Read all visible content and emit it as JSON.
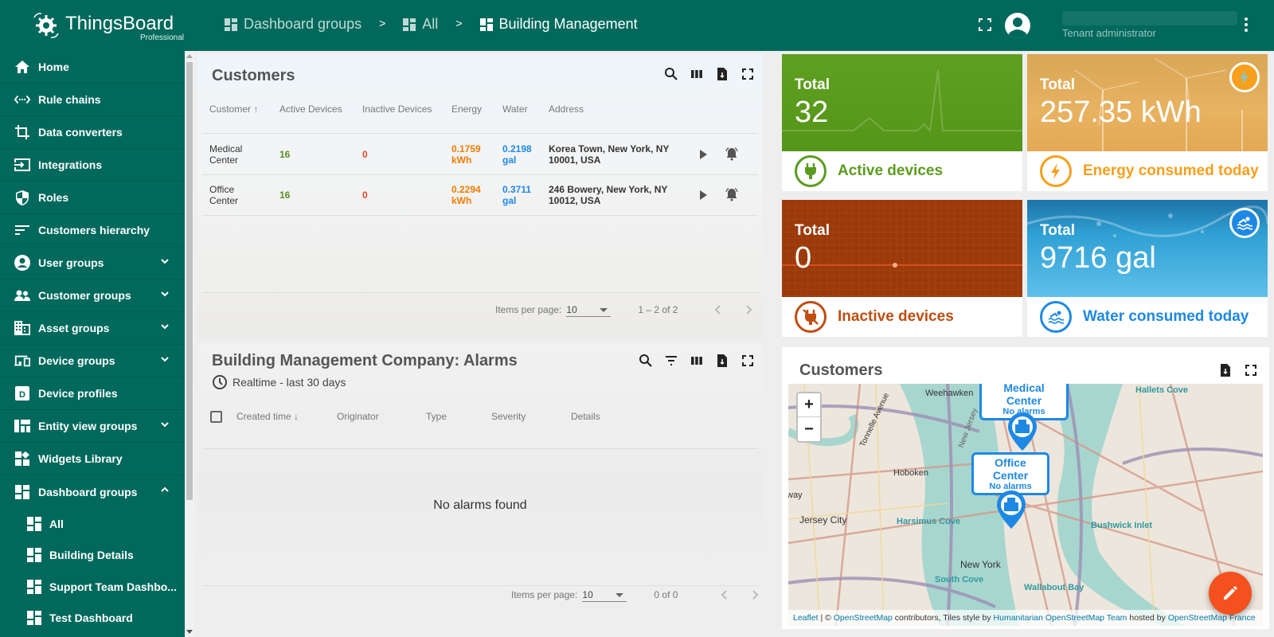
{
  "app": {
    "logo_name": "ThingsBoard",
    "logo_edition": "Professional"
  },
  "breadcrumb": [
    {
      "label": "Dashboard groups"
    },
    {
      "label": "All"
    },
    {
      "label": "Building Management"
    }
  ],
  "breadcrumb_separator": ">",
  "user": {
    "role": "Tenant administrator"
  },
  "sidebar": {
    "items": [
      {
        "label": "Home",
        "icon": "home-icon"
      },
      {
        "label": "Rule chains",
        "icon": "rule-chains-icon"
      },
      {
        "label": "Data converters",
        "icon": "crop-icon"
      },
      {
        "label": "Integrations",
        "icon": "input-icon"
      },
      {
        "label": "Roles",
        "icon": "shield-icon"
      },
      {
        "label": "Customers hierarchy",
        "icon": "sort-icon"
      },
      {
        "label": "User groups",
        "icon": "account-circle-icon",
        "expandable": true
      },
      {
        "label": "Customer groups",
        "icon": "supervisor-icon",
        "expandable": true
      },
      {
        "label": "Asset groups",
        "icon": "domain-icon",
        "expandable": true
      },
      {
        "label": "Device groups",
        "icon": "devices-icon",
        "expandable": true
      },
      {
        "label": "Device profiles",
        "icon": "device-profile-icon"
      },
      {
        "label": "Entity view groups",
        "icon": "view-quilt-icon",
        "expandable": true
      },
      {
        "label": "Widgets Library",
        "icon": "widgets-icon"
      },
      {
        "label": "Dashboard groups",
        "icon": "dashboard-icon",
        "expanded": true
      }
    ],
    "sub_items": [
      {
        "label": "All"
      },
      {
        "label": "Building Details"
      },
      {
        "label": "Support Team Dashbo..."
      },
      {
        "label": "Test Dashboard"
      }
    ]
  },
  "customers_table": {
    "title": "Customers",
    "columns": [
      "Customer",
      "Active Devices",
      "Inactive Devices",
      "Energy",
      "Water",
      "Address"
    ],
    "sort_indicator": "↑",
    "rows": [
      {
        "customer_l1": "Medical",
        "customer_l2": "Center",
        "active": "16",
        "inactive": "0",
        "energy_val": "0.1759",
        "energy_unit": "kWh",
        "water_val": "0.2198",
        "water_unit": "gal",
        "address_l1": "Korea Town, New York, NY",
        "address_l2": "10001, USA"
      },
      {
        "customer_l1": "Office",
        "customer_l2": "Center",
        "active": "16",
        "inactive": "0",
        "energy_val": "0.2294",
        "energy_unit": "kWh",
        "water_val": "0.3711",
        "water_unit": "gal",
        "address_l1": "246 Bowery, New York, NY",
        "address_l2": "10012, USA"
      }
    ],
    "pager": {
      "label": "Items per page:",
      "page_size": "10",
      "range": "1 – 2 of 2"
    }
  },
  "alarms_table": {
    "title": "Building Management Company: Alarms",
    "timewindow": "Realtime - last 30 days",
    "columns": [
      "Created time",
      "Originator",
      "Type",
      "Severity",
      "Details"
    ],
    "sort_indicator": "↓",
    "empty_text": "No alarms found",
    "pager": {
      "label": "Items per page:",
      "page_size": "10",
      "range": "0 of 0"
    }
  },
  "cards": [
    {
      "total_label": "Total",
      "value": "32",
      "label": "Active devices",
      "color": "#5b9c1f"
    },
    {
      "total_label": "Total",
      "value": "257.35 kWh",
      "label": "Energy consumed today",
      "color": "#f89f1b"
    },
    {
      "total_label": "Total",
      "value": "0",
      "label": "Inactive devices",
      "color": "#bf4e11"
    },
    {
      "total_label": "Total",
      "value": "9716 gal",
      "label": "Water consumed today",
      "color": "#1e88e5"
    }
  ],
  "map_widget": {
    "title": "Customers",
    "markers": [
      {
        "name": "Medical Center",
        "status": "No alarms"
      },
      {
        "name": "Office Center",
        "status": "No alarms"
      }
    ],
    "place_labels": [
      "Weehawken",
      "Tonnelle Avenue",
      "New Jersey",
      "Hoboken",
      "Jersey City",
      "Harsimus Cove",
      "Hallets Cove",
      "Bushwick Inlet",
      "New York",
      "South Cove",
      "Wallabout Bay",
      "way"
    ],
    "zoom_in": "+",
    "zoom_out": "−",
    "attribution": {
      "leaflet": "Leaflet",
      "sep": " | © ",
      "osm": "OpenStreetMap",
      "contrib": " contributors, Tiles style by ",
      "hot": "Humanitarian OpenStreetMap Team",
      "hosted": " hosted by ",
      "osmfr": "OpenStreetMap France"
    }
  }
}
